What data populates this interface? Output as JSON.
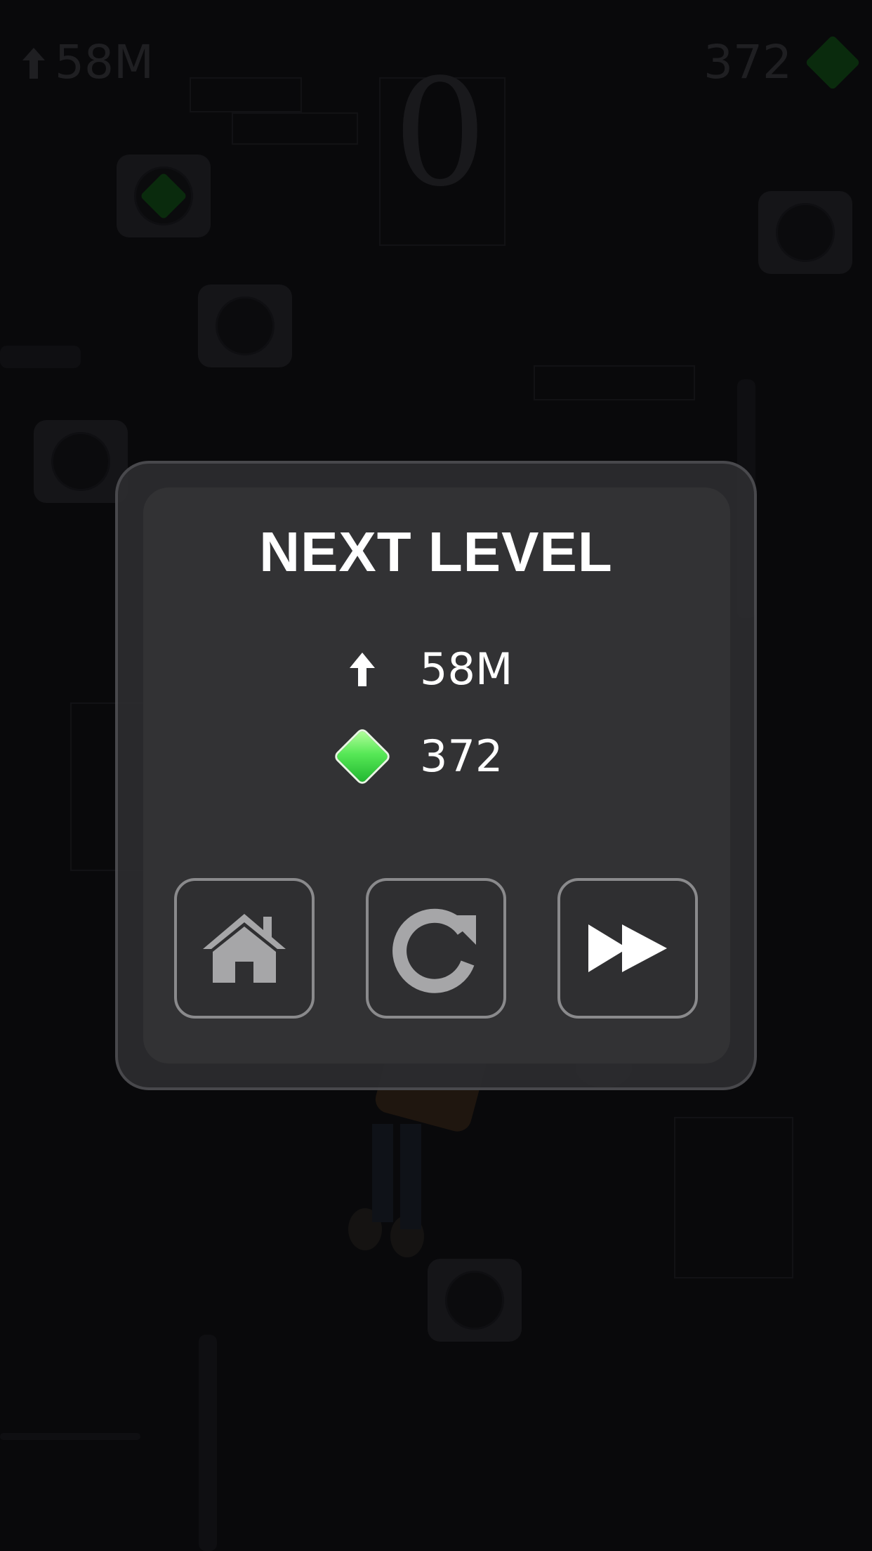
{
  "hud": {
    "height_label": "58M",
    "gems_label": "372",
    "score": "0"
  },
  "dialog": {
    "title": "NEXT LEVEL",
    "height_value": "58M",
    "gems_value": "372"
  },
  "buttons": {
    "home_icon": "home-icon",
    "retry_icon": "restart-icon",
    "next_icon": "fast-forward-icon"
  },
  "colors": {
    "gem": "#3ddc4a",
    "panel": "#323234",
    "panel_border": "#4b4b4f",
    "button_border": "#8a8a8c"
  }
}
